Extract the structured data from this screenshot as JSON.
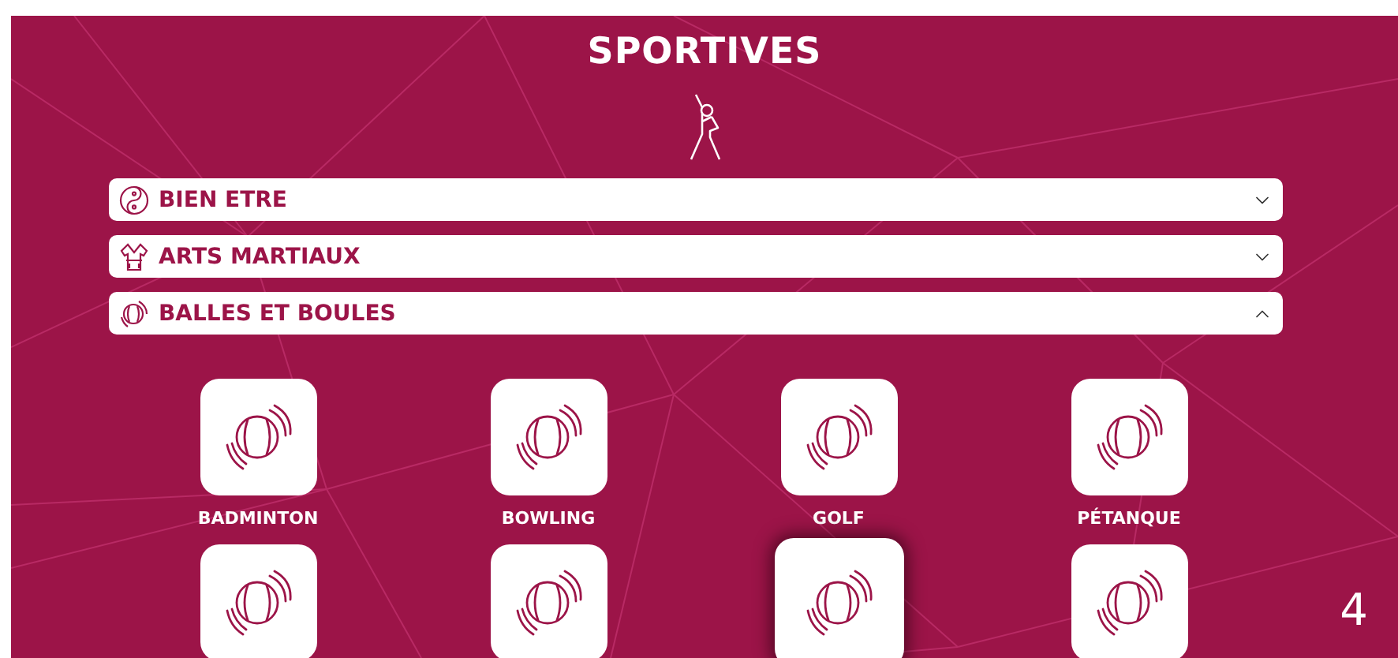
{
  "title": "SPORTIVES",
  "categories": [
    {
      "label": "BIEN ETRE",
      "kind": "wellness",
      "expanded": false
    },
    {
      "label": "ARTS MARTIAUX",
      "kind": "martial",
      "expanded": false
    },
    {
      "label": "BALLES ET BOULES",
      "kind": "balls",
      "expanded": true
    }
  ],
  "sports": [
    {
      "label": "BADMINTON",
      "selected": false
    },
    {
      "label": "BOWLING",
      "selected": false
    },
    {
      "label": "GOLF",
      "selected": false
    },
    {
      "label": "PÉTANQUE",
      "selected": false
    },
    {
      "selected": false
    },
    {
      "selected": false
    },
    {
      "selected": true
    },
    {
      "selected": false
    }
  ],
  "page_number": "4"
}
